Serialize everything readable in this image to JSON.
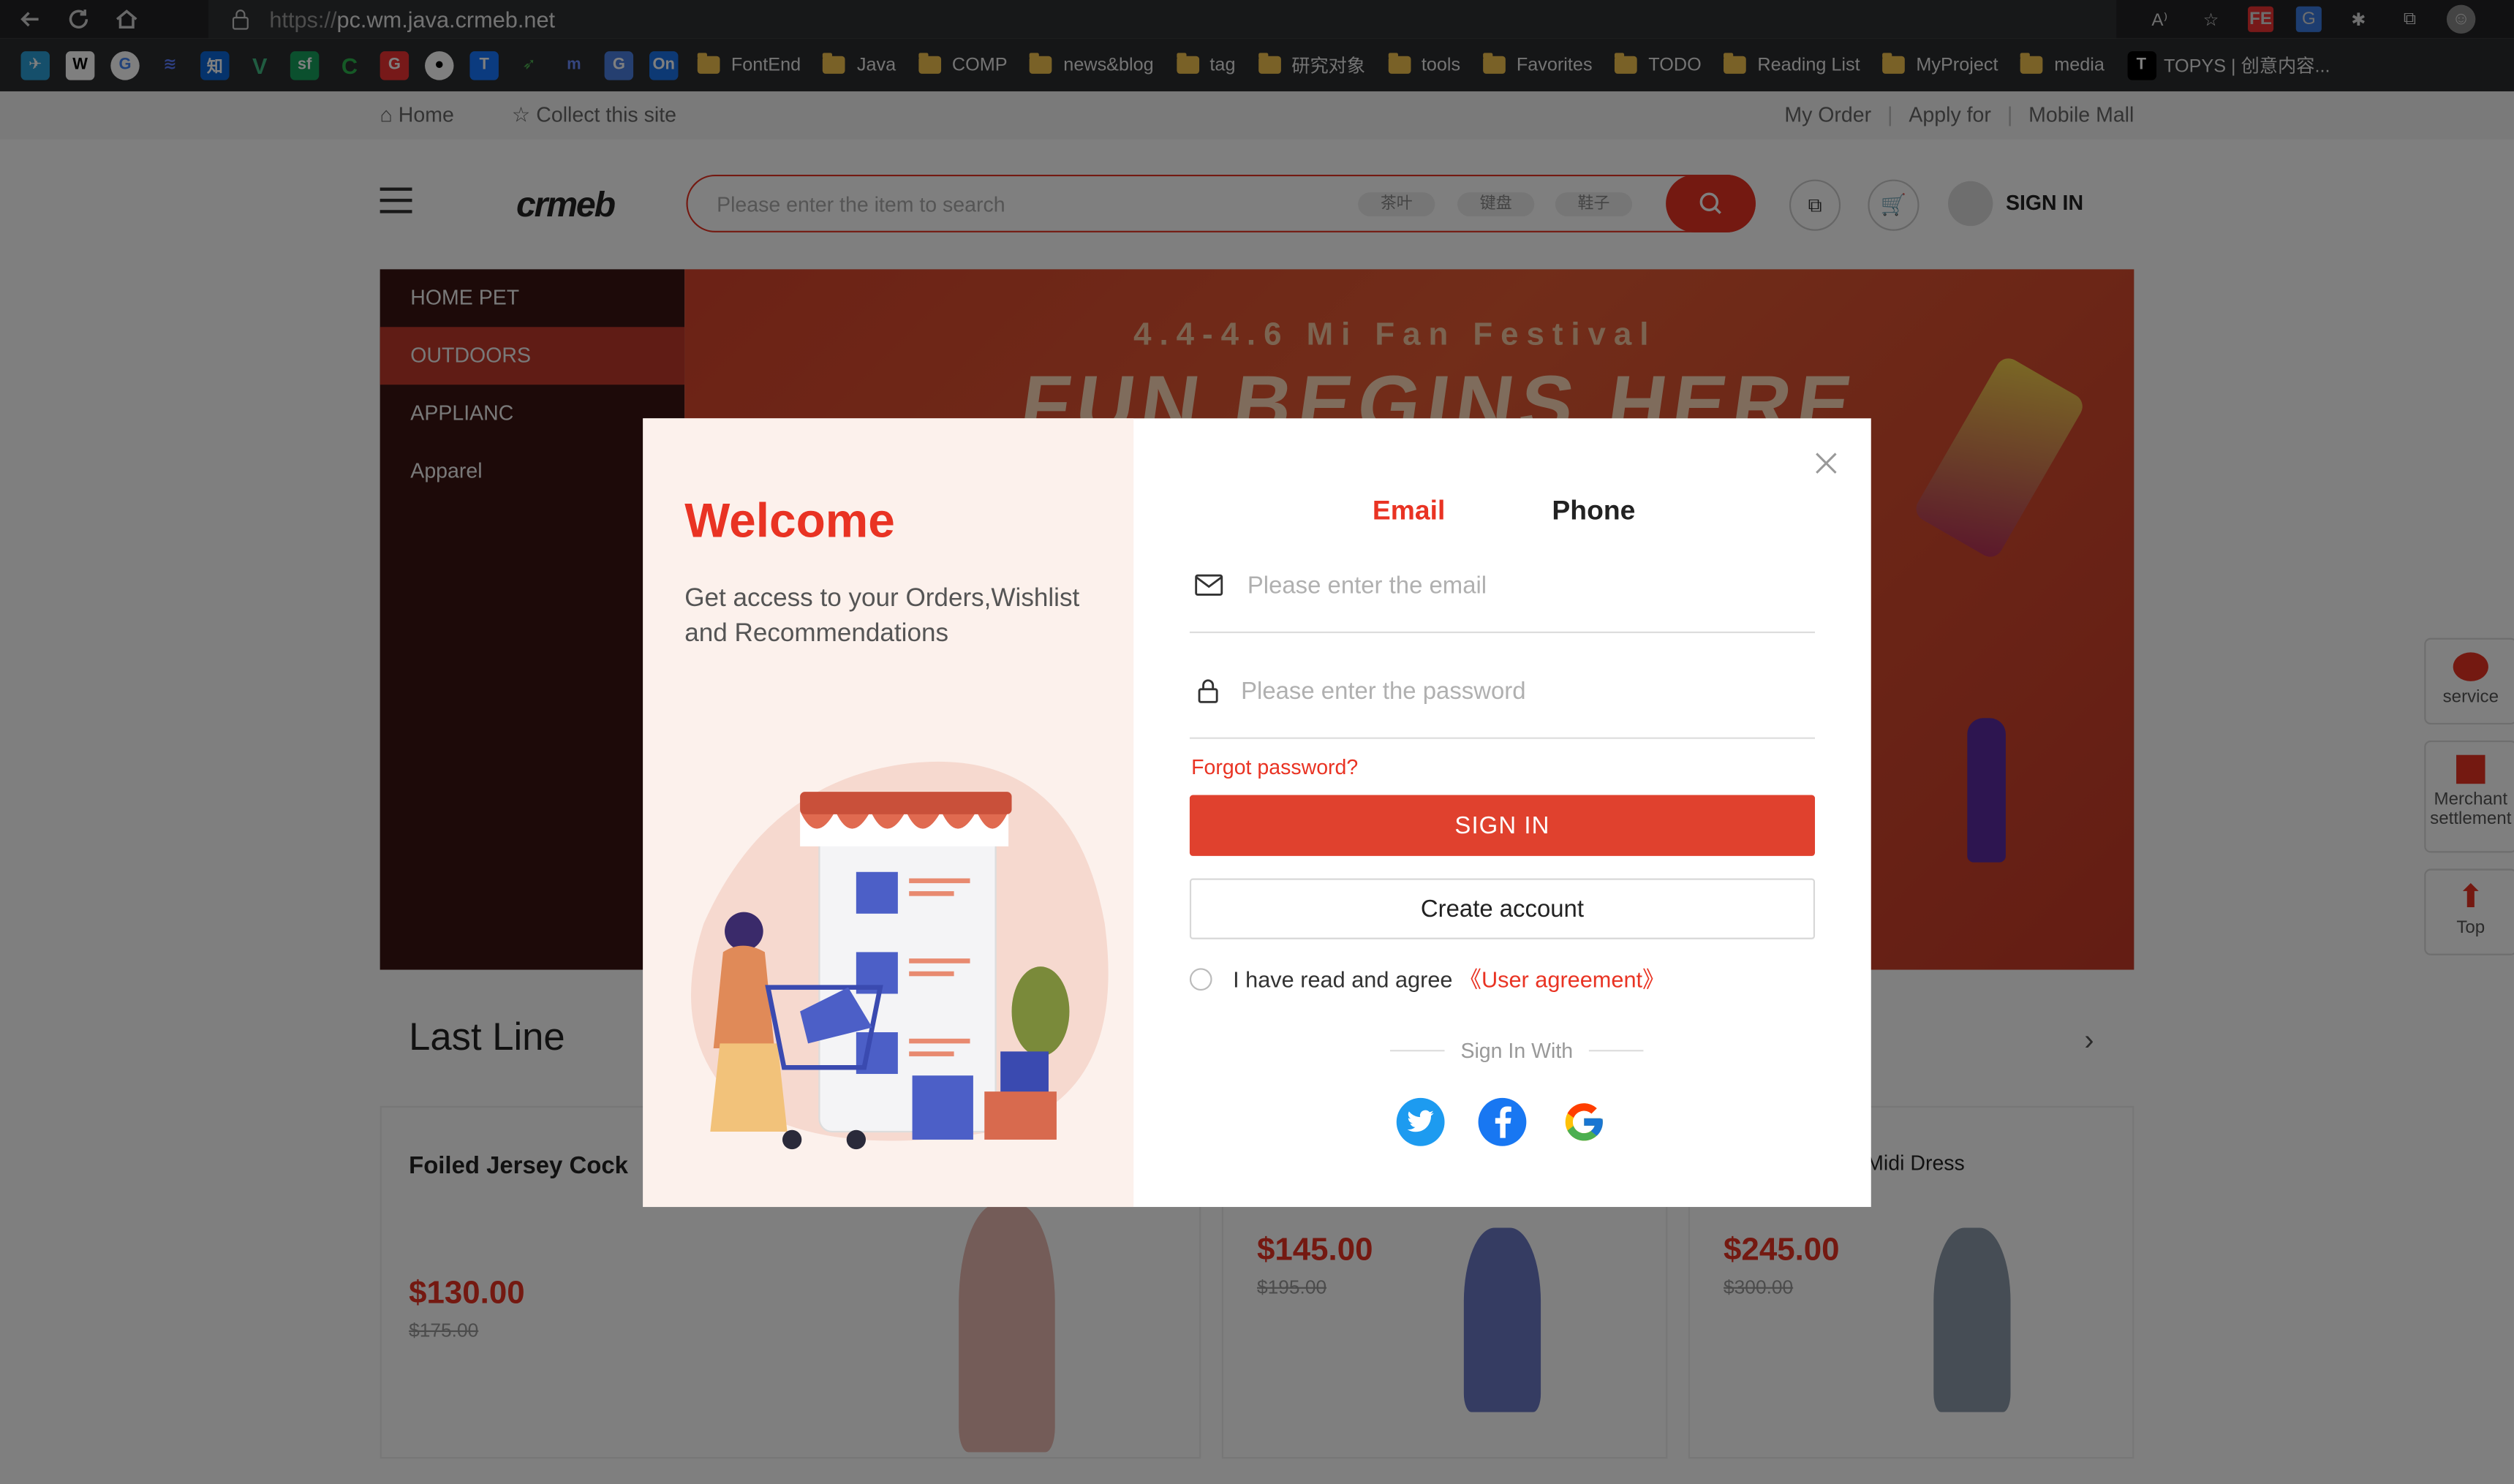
{
  "browser": {
    "url_proto": "https://",
    "url_host": "pc.wm.java.crmeb.net",
    "bookmarks": [
      "FontEnd",
      "Java",
      "COMP",
      "news&blog",
      "tag",
      "研究对象",
      "tools",
      "Favorites",
      "TODO",
      "Reading List",
      "MyProject",
      "media",
      "TOPYS | 创意内容..."
    ]
  },
  "topbar": {
    "home": "Home",
    "collect": "Collect this site",
    "my_order": "My Order",
    "apply_for": "Apply for",
    "mobile_mall": "Mobile Mall"
  },
  "header": {
    "logo": "crmeb",
    "search_placeholder": "Please enter the item to search",
    "search_tags": [
      "茶叶",
      "键盘",
      "鞋子"
    ],
    "sign_in": "SIGN IN"
  },
  "sidemenu": [
    "HOME PET",
    "OUTDOORS",
    "APPLIANC",
    "Apparel"
  ],
  "banner": {
    "festival": "4.4-4.6 Mi Fan Festival",
    "headline": "FUN BEGINS HERE"
  },
  "section": {
    "title": "Last Line"
  },
  "products": [
    {
      "name": "Foiled Jersey Cock",
      "price": "$130.00",
      "old_price": "$175.00"
    },
    {
      "name": "",
      "price": "$145.00",
      "old_price": "$195.00"
    },
    {
      "name": "Midi Dress",
      "price": "$245.00",
      "old_price": "$300.00"
    }
  ],
  "rail": {
    "service": "service",
    "merchant1": "Merchant",
    "merchant2": "settlement",
    "top": "Top"
  },
  "modal": {
    "welcome": "Welcome",
    "description": "Get access to your Orders,Wishlist and Recommendations",
    "tab_email": "Email",
    "tab_phone": "Phone",
    "email_placeholder": "Please enter the email",
    "password_placeholder": "Please enter the password",
    "forgot": "Forgot password?",
    "sign_in_button": "SIGN IN",
    "create_account": "Create account",
    "agree_text": "I have read and agree",
    "agreement_link": "《User agreement》",
    "sign_in_with": "Sign In With"
  },
  "colors": {
    "accent": "#e93323",
    "overlay": "rgba(0,0,0,0.5)"
  }
}
